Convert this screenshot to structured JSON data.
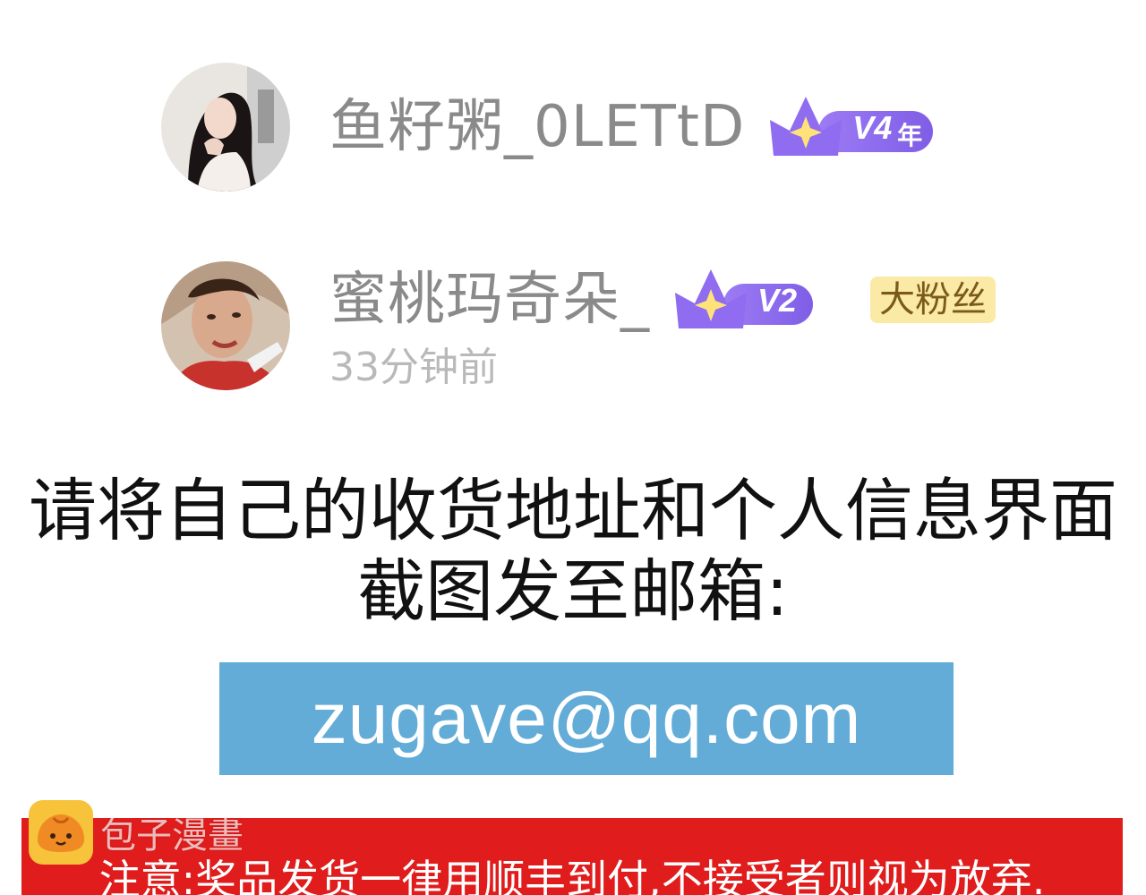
{
  "comments": [
    {
      "username": "鱼籽粥_0LETtD",
      "vip_level": "V4",
      "vip_suffix": "年"
    },
    {
      "username": "蜜桃玛奇朵_",
      "vip_level": "V2",
      "fan_badge": "大粉丝",
      "timestamp": "33分钟前"
    }
  ],
  "instruction": {
    "line1": "请将自己的收货地址和个人信息界面",
    "line2": "截图发至邮箱:"
  },
  "email": "zugave@qq.com",
  "notice": "注意:奖品发货一律用顺丰到付,不接受者则视为放弃.",
  "watermark": {
    "text": "包子漫畫",
    "icon": "bun-logo-icon"
  },
  "colors": {
    "email_box": "#62acd7",
    "notice_bar": "#e01c1c",
    "vip_purple": "#8b6cf0",
    "fan_badge_bg": "#fbe9a6",
    "watermark_logo": "#f6c33a"
  }
}
